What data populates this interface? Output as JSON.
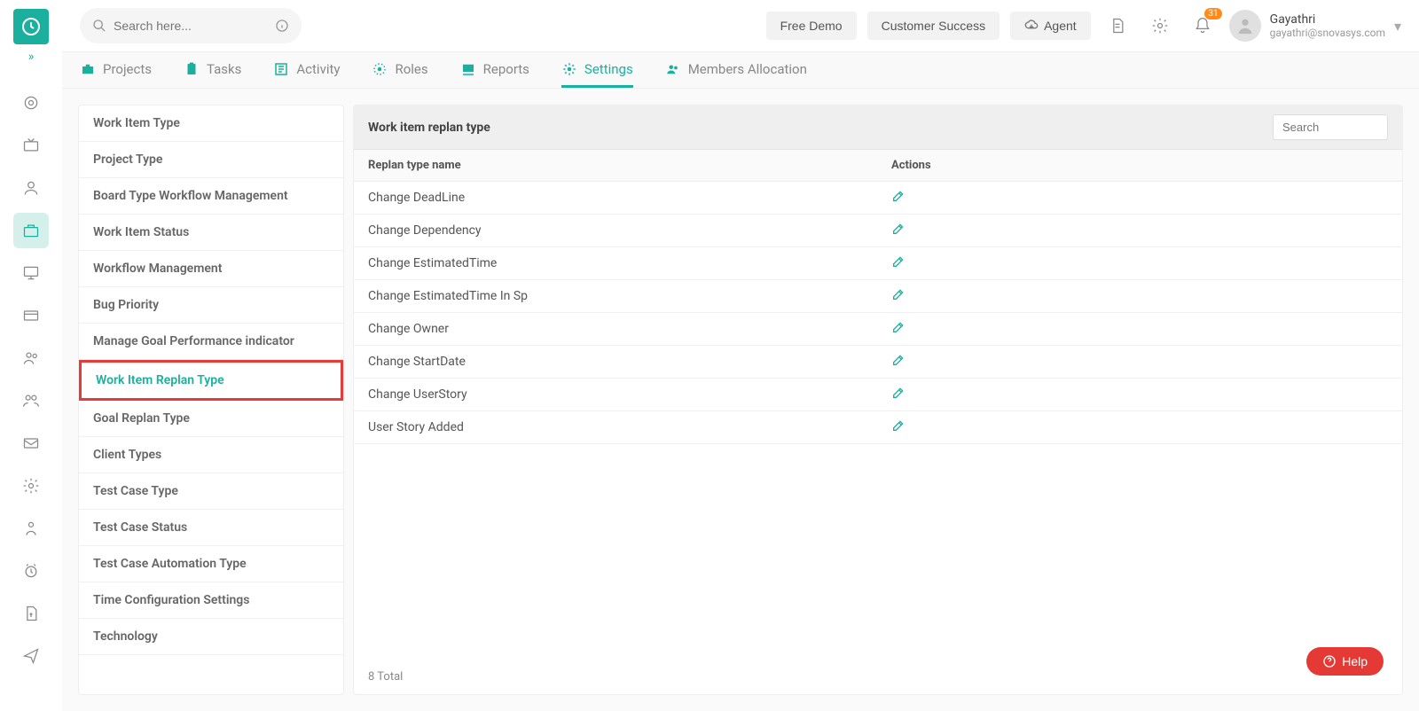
{
  "header": {
    "search_placeholder": "Search here...",
    "buttons": {
      "free_demo": "Free Demo",
      "customer_success": "Customer Success",
      "agent": "Agent"
    },
    "notif_count": "31",
    "user": {
      "name": "Gayathri",
      "email": "gayathri@snovasys.com"
    }
  },
  "tabs": {
    "projects": "Projects",
    "tasks": "Tasks",
    "activity": "Activity",
    "roles": "Roles",
    "reports": "Reports",
    "settings": "Settings",
    "members": "Members Allocation"
  },
  "side_panel": {
    "items": [
      "Work Item Type",
      "Project Type",
      "Board Type Workflow Management",
      "Work Item Status",
      "Workflow Management",
      "Bug Priority",
      "Manage Goal Performance indicator",
      "Work Item Replan Type",
      "Goal Replan Type",
      "Client Types",
      "Test Case Type",
      "Test Case Status",
      "Test Case Automation Type",
      "Time Configuration Settings",
      "Technology"
    ],
    "active_index": 7
  },
  "content": {
    "title": "Work item replan type",
    "search_placeholder": "Search",
    "columns": {
      "name": "Replan type name",
      "actions": "Actions"
    },
    "rows": [
      "Change DeadLine",
      "Change Dependency",
      "Change EstimatedTime",
      "Change EstimatedTime In Sp",
      "Change Owner",
      "Change StartDate",
      "Change UserStory",
      "User Story Added"
    ],
    "total_label": "8 Total"
  },
  "help_label": "Help"
}
